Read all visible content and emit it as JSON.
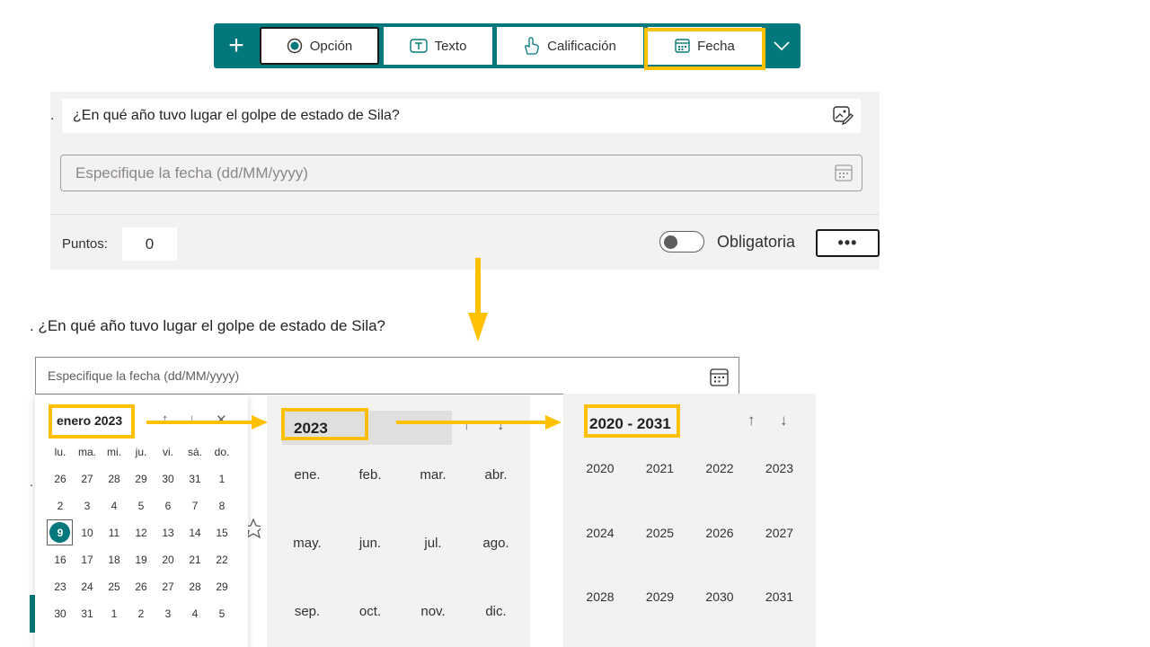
{
  "toolbar": {
    "add_label": "+",
    "buttons": [
      {
        "label": "Opción",
        "icon": "radio-icon"
      },
      {
        "label": "Texto",
        "icon": "text-icon"
      },
      {
        "label": "Calificación",
        "icon": "thumb-icon"
      },
      {
        "label": "Fecha",
        "icon": "calendar-icon"
      }
    ],
    "more_icon": "chevron-down-icon",
    "accent": "#03787c"
  },
  "question_card": {
    "number_dot": ".",
    "title": "¿En qué año tuvo lugar el golpe de estado de Sila?",
    "date_placeholder": "Especifique la fecha (dd/MM/yyyy)",
    "points_label": "Puntos:",
    "points_value": "0",
    "required_label": "Obligatoria",
    "more_label": "•••"
  },
  "preview": {
    "question": ". ¿En qué año tuvo lugar el golpe de estado de Sila?",
    "date_placeholder": "Especifique la fecha (dd/MM/yyyy)",
    "side_dot": "."
  },
  "day_picker": {
    "title": "enero 2023",
    "nav": [
      "↑",
      "↓",
      "✕"
    ],
    "weekdays": [
      "lu.",
      "ma.",
      "mi.",
      "ju.",
      "vi.",
      "sá.",
      "do."
    ],
    "weeks": [
      [
        "26",
        "27",
        "28",
        "29",
        "30",
        "31",
        "1"
      ],
      [
        "2",
        "3",
        "4",
        "5",
        "6",
        "7",
        "8"
      ],
      [
        "9",
        "10",
        "11",
        "12",
        "13",
        "14",
        "15"
      ],
      [
        "16",
        "17",
        "18",
        "19",
        "20",
        "21",
        "22"
      ],
      [
        "23",
        "24",
        "25",
        "26",
        "27",
        "28",
        "29"
      ],
      [
        "30",
        "31",
        "1",
        "2",
        "3",
        "4",
        "5"
      ]
    ],
    "selected_day": "9"
  },
  "month_picker": {
    "year": "2023",
    "nav": [
      "↑",
      "↓"
    ],
    "months": [
      "ene.",
      "feb.",
      "mar.",
      "abr.",
      "may.",
      "jun.",
      "jul.",
      "ago.",
      "sep.",
      "oct.",
      "nov.",
      "dic."
    ]
  },
  "year_picker": {
    "range": "2020 - 2031",
    "nav": [
      "↑",
      "↓"
    ],
    "years": [
      "2020",
      "2021",
      "2022",
      "2023",
      "2024",
      "2025",
      "2026",
      "2027",
      "2028",
      "2029",
      "2030",
      "2031"
    ]
  },
  "highlight_color": "#ffc000"
}
